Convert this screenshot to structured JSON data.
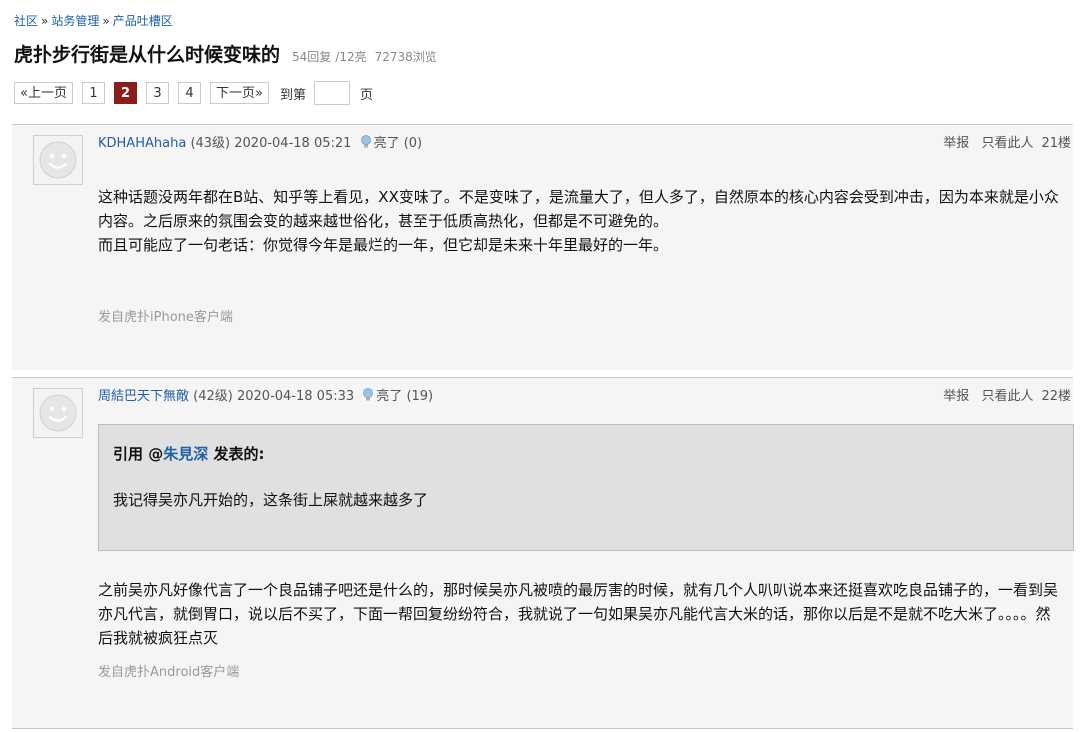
{
  "breadcrumb": {
    "items": [
      "社区",
      "站务管理",
      "产品吐槽区"
    ],
    "separator": "»"
  },
  "thread": {
    "title": "虎扑步行街是从什么时候变味的",
    "replies": "54回复",
    "lights": "/12亮",
    "views": "72738浏览"
  },
  "pager": {
    "prev": "«上一页",
    "pages": [
      "1",
      "2",
      "3",
      "4"
    ],
    "current": "2",
    "next": "下一页»",
    "goto_label": "到第",
    "goto_value": "",
    "page_unit": "页"
  },
  "posts": [
    {
      "author": "KDHAHAhaha",
      "level": "(43级)",
      "time": "2020-04-18 05:21",
      "light_label": "亮了",
      "light_count": "(0)",
      "report": "举报",
      "only_author": "只看此人",
      "floor": "21楼",
      "paragraphs": [
        "这种话题没两年都在B站、知乎等上看见，XX变味了。不是变味了，是流量大了，但人多了，自然原本的核心内容会受到冲击，因为本来就是小众内容。之后原来的氛围会变的越来越世俗化，甚至于低质高热化，但都是不可避免的。",
        "而且可能应了一句老话：你觉得今年是最烂的一年，但它却是未来十年里最好的一年。"
      ],
      "client": "发自虎扑iPhone客户端"
    },
    {
      "author": "周結巴天下無敵",
      "level": "(42级)",
      "time": "2020-04-18 05:33",
      "light_label": "亮了",
      "light_count": "(19)",
      "report": "举报",
      "only_author": "只看此人",
      "floor": "22楼",
      "quote": {
        "prefix": "引用 @",
        "user": "朱見深",
        "suffix": " 发表的:",
        "text": "我记得吴亦凡开始的，这条街上屎就越来越多了"
      },
      "paragraphs": [
        "之前吴亦凡好像代言了一个良品铺子吧还是什么的，那时候吴亦凡被喷的最厉害的时候，就有几个人叭叭说本来还挺喜欢吃良品铺子的，一看到吴亦凡代言，就倒胃口，说以后不买了，下面一帮回复纷纷符合，我就说了一句如果吴亦凡能代言大米的话，那你以后是不是就不吃大米了。。。。然后我就被疯狂点灭"
      ],
      "client": "发自虎扑Android客户端"
    }
  ],
  "colors": {
    "link": "#1f5fa8",
    "current_page": "#8b1c1c",
    "post_bg": "#f5f5f5",
    "quote_bg": "#e0e0e0"
  }
}
